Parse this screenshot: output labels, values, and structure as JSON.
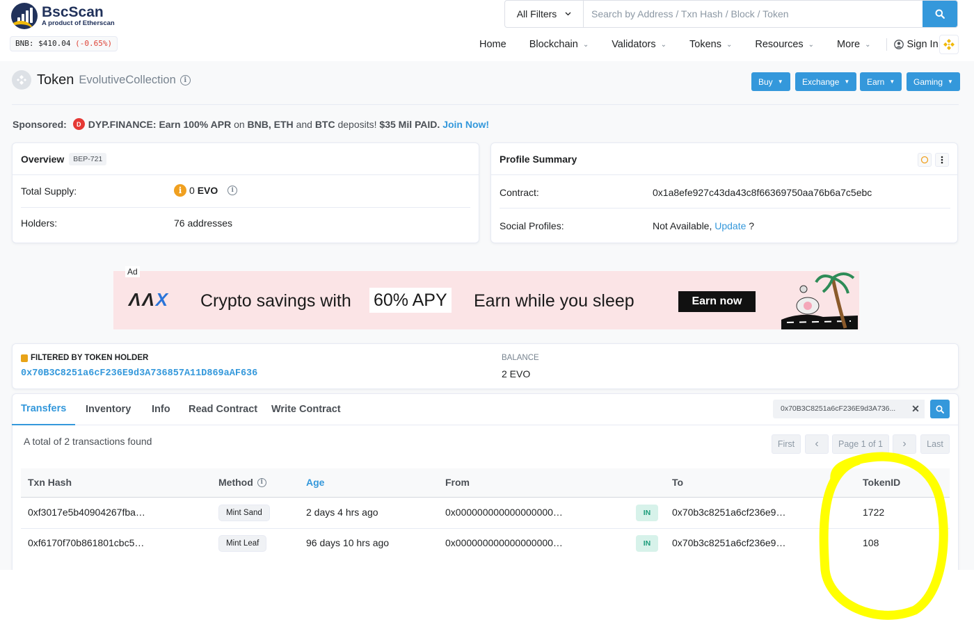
{
  "brand": {
    "name": "BscScan",
    "tagline": "A product of Etherscan",
    "price_label": "BNB: $410.04",
    "price_change": "(-0.65%)"
  },
  "search": {
    "filter_label": "All Filters",
    "placeholder": "Search by Address / Txn Hash / Block / Token"
  },
  "nav": {
    "home": "Home",
    "blockchain": "Blockchain",
    "validators": "Validators",
    "tokens": "Tokens",
    "resources": "Resources",
    "more": "More",
    "signin": "Sign In"
  },
  "title": {
    "token": "Token",
    "name": "EvolutiveCollection"
  },
  "action_buttons": {
    "buy": "Buy",
    "exchange": "Exchange",
    "earn": "Earn",
    "gaming": "Gaming"
  },
  "sponsored": {
    "label": "Sponsored:",
    "brand": "DYP.FINANCE:",
    "t1": "Earn 100% APR",
    "t2": "on",
    "t3": "BNB, ETH",
    "t4": "and",
    "t5": "BTC",
    "t6": "deposits!",
    "t7": "$35 Mil PAID.",
    "cta": "Join Now!"
  },
  "overview": {
    "title": "Overview",
    "badge": "BEP-721",
    "supply_label": "Total Supply:",
    "supply_value": "0",
    "supply_unit": "EVO",
    "holders_label": "Holders:",
    "holders_value": "76 addresses"
  },
  "profile": {
    "title": "Profile Summary",
    "contract_label": "Contract:",
    "contract_value": "0x1a8efe927c43da43c8f66369750aa76b6a7c5ebc",
    "social_label": "Social Profiles:",
    "social_value": "Not Available,",
    "social_link": "Update",
    "social_q": "?"
  },
  "ad": {
    "label": "Ad",
    "logo_a": "ΛΛ",
    "logo_x": "X",
    "text1": "Crypto savings with",
    "apy": "60% APY",
    "text2": "Earn while you sleep",
    "cta": "Earn now"
  },
  "filter": {
    "title": "FILTERED BY TOKEN HOLDER",
    "address": "0x70B3C8251a6cF236E9d3A736857A11D869aAF636",
    "balance_label": "BALANCE",
    "balance_value": "2 EVO"
  },
  "tabs": {
    "transfers": "Transfers",
    "inventory": "Inventory",
    "info": "Info",
    "read": "Read Contract",
    "write": "Write Contract",
    "search_value": "0x70B3C8251a6cF236E9d3A736..."
  },
  "summary": "A total of 2 transactions found",
  "pager": {
    "first": "First",
    "prev": "‹",
    "page": "Page 1 of 1",
    "next": "›",
    "last": "Last"
  },
  "table": {
    "headers": {
      "hash": "Txn Hash",
      "method": "Method",
      "age": "Age",
      "from": "From",
      "to": "To",
      "tokenid": "TokenID"
    },
    "rows": [
      {
        "hash": "0xf3017e5b40904267fba…",
        "method": "Mint Sand",
        "age": "2 days 4 hrs ago",
        "from": "0x000000000000000000…",
        "dir": "IN",
        "to": "0x70b3c8251a6cf236e9…",
        "tokenid": "1722"
      },
      {
        "hash": "0xf6170f70b861801cbc5…",
        "method": "Mint Leaf",
        "age": "96 days 10 hrs ago",
        "from": "0x000000000000000000…",
        "dir": "IN",
        "to": "0x70b3c8251a6cf236e9…",
        "tokenid": "108"
      }
    ]
  },
  "colors": {
    "accent": "#3498db",
    "highlight": "#ffff00",
    "negative": "#de4437"
  }
}
